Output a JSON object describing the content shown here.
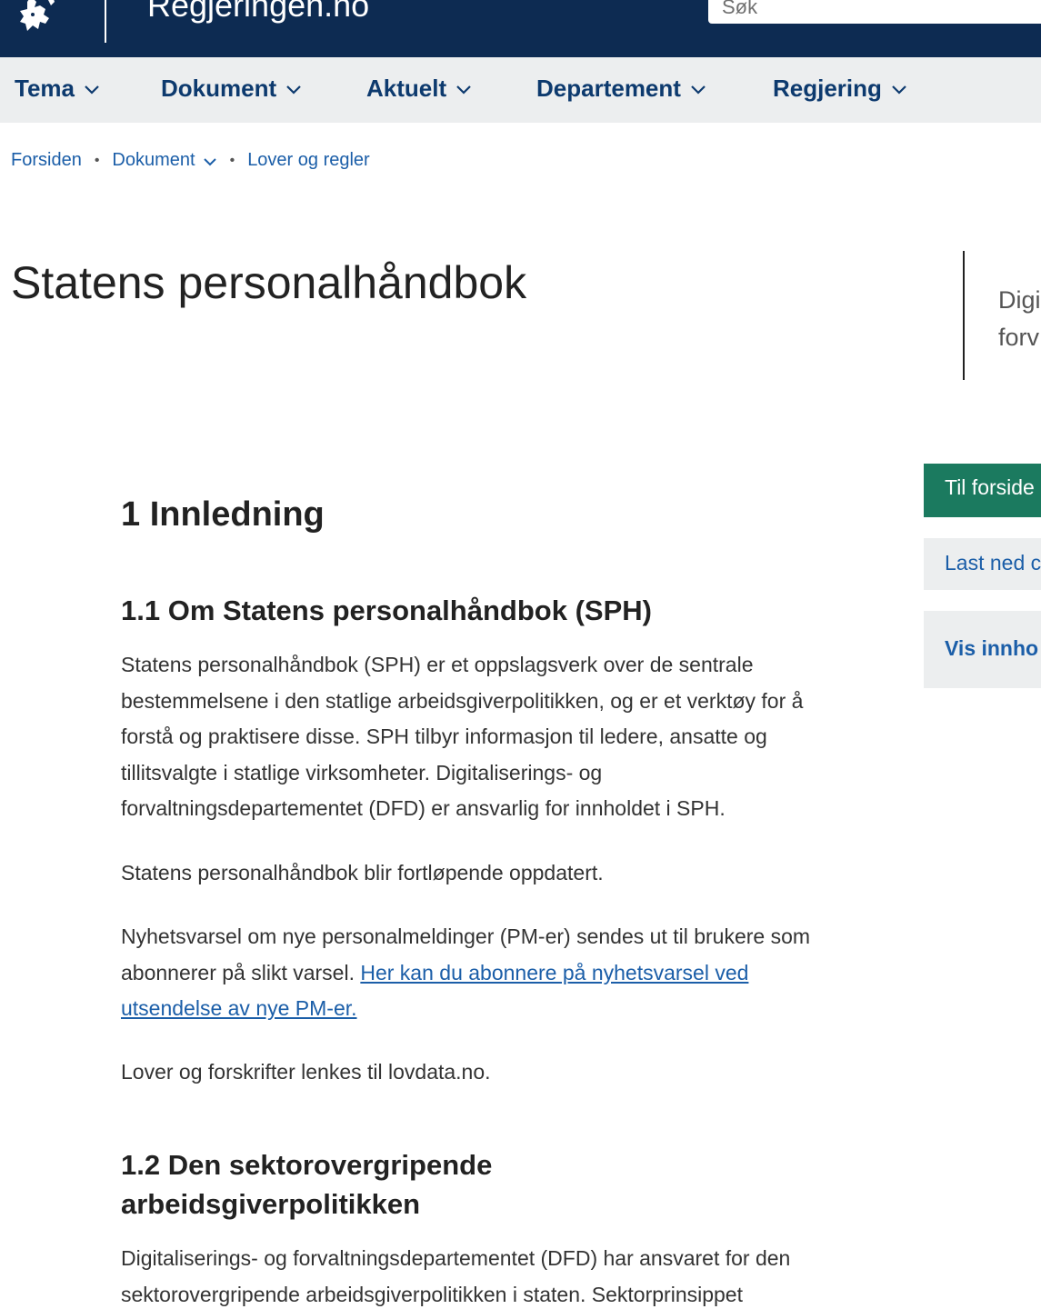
{
  "header": {
    "site_name": "Regjeringen.no",
    "search_placeholder": "Søk"
  },
  "nav": {
    "items": [
      {
        "label": "Tema"
      },
      {
        "label": "Dokument"
      },
      {
        "label": "Aktuelt"
      },
      {
        "label": "Departement"
      },
      {
        "label": "Regjering"
      }
    ]
  },
  "breadcrumb": {
    "home": "Forsiden",
    "dokument": "Dokument",
    "current": "Lover og regler"
  },
  "page": {
    "title": "Statens personalhåndbok"
  },
  "aside": {
    "line1": "Digi",
    "line2": "forv",
    "btn_forside": "Til forside",
    "btn_lastned": "Last ned c",
    "btn_vis": "Vis innho"
  },
  "content": {
    "h_innledning": "1 Innledning",
    "h_1_1": "1.1 Om Statens personalhåndbok (SPH)",
    "p1": "Statens personalhåndbok (SPH) er et oppslagsverk over de sentrale bestemmelsene i den statlige arbeidsgiverpolitikken, og er et verktøy for å forstå og praktisere disse. SPH tilbyr informasjon til ledere, ansatte og tillitsvalgte i statlige virksomheter. Digitaliserings- og forvaltningsdepartementet (DFD) er ansvarlig for innholdet i SPH.",
    "p2": "Statens personalhåndbok blir fortløpende oppdatert.",
    "p3_text": "Nyhetsvarsel om nye personalmeldinger (PM-er) sendes ut til brukere som abonnerer på slikt varsel.",
    "p3_link": "Her kan du abonnere på nyhetsvarsel ved utsendelse av nye PM-er.",
    "p4": "Lover og forskrifter lenkes til lovdata.no.",
    "h_1_2": "1.2 Den sektorovergripende arbeidsgiverpolitikken",
    "p5": "Digitaliserings- og forvaltningsdepartementet (DFD) har ansvaret for den sektorovergripende arbeidsgiverpolitikken i staten. Sektorprinsippet"
  },
  "colors": {
    "header_bg": "#0d2b52",
    "nav_bg": "#eceeef",
    "nav_text": "#0d3a6e",
    "link": "#1b5ea8",
    "green_button": "#1b7a5f"
  }
}
